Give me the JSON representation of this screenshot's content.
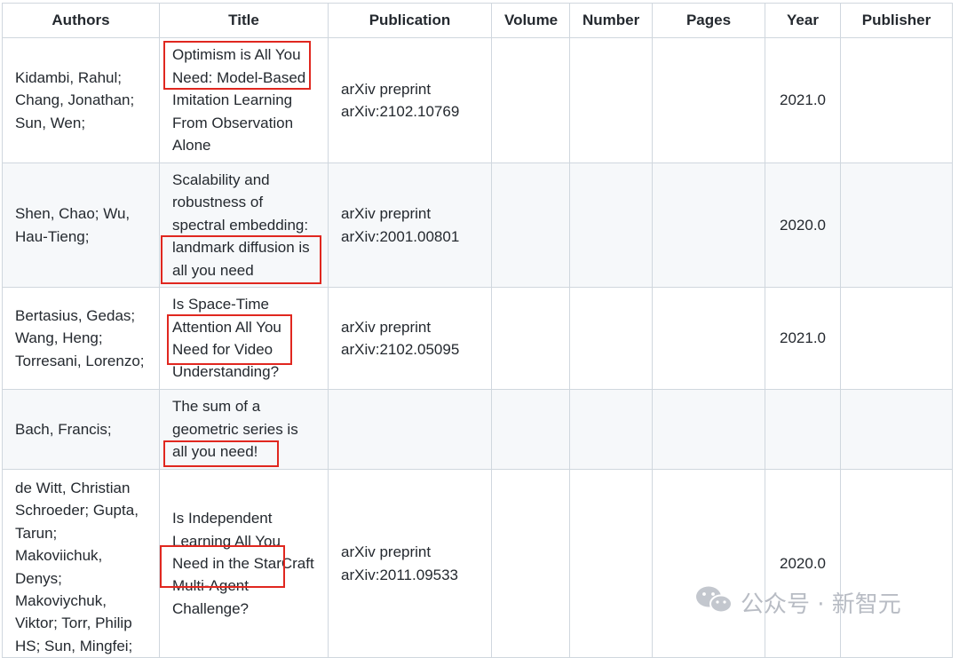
{
  "table": {
    "headers": [
      "Authors",
      "Title",
      "Publication",
      "Volume",
      "Number",
      "Pages",
      "Year",
      "Publisher"
    ],
    "rows": [
      {
        "authors": "Kidambi, Rahul; Chang, Jonathan; Sun, Wen;",
        "title": "Optimism is All You Need: Model-Based Imitation Learning From Observation Alone",
        "publication": "arXiv preprint arXiv:2102.10769",
        "volume": "",
        "number": "",
        "pages": "",
        "year": "2021.0",
        "publisher": ""
      },
      {
        "authors": "Shen, Chao; Wu, Hau-Tieng;",
        "title": "Scalability and robustness of spectral embedding: landmark diffusion is all you need",
        "publication": "arXiv preprint arXiv:2001.00801",
        "volume": "",
        "number": "",
        "pages": "",
        "year": "2020.0",
        "publisher": ""
      },
      {
        "authors": "Bertasius, Gedas; Wang, Heng; Torresani, Lorenzo;",
        "title": "Is Space-Time Attention All You Need for Video Understanding?",
        "publication": "arXiv preprint arXiv:2102.05095",
        "volume": "",
        "number": "",
        "pages": "",
        "year": "2021.0",
        "publisher": ""
      },
      {
        "authors": "Bach, Francis;",
        "title": "The sum of a geometric series is all you need!",
        "publication": "",
        "volume": "",
        "number": "",
        "pages": "",
        "year": "",
        "publisher": ""
      },
      {
        "authors": "de Witt, Christian Schroeder; Gupta, Tarun; Makoviichuk, Denys; Makoviychuk, Viktor; Torr, Philip HS; Sun, Mingfei;",
        "title": "Is Independent Learning All You Need in the StarCraft Multi-Agent Challenge?",
        "publication": "arXiv preprint arXiv:2011.09533",
        "volume": "",
        "number": "",
        "pages": "",
        "year": "2020.0",
        "publisher": ""
      }
    ]
  },
  "highlight_color": "#e0271f",
  "watermark": {
    "icon": "wechat-icon",
    "text": "公众号 · 新智元"
  }
}
